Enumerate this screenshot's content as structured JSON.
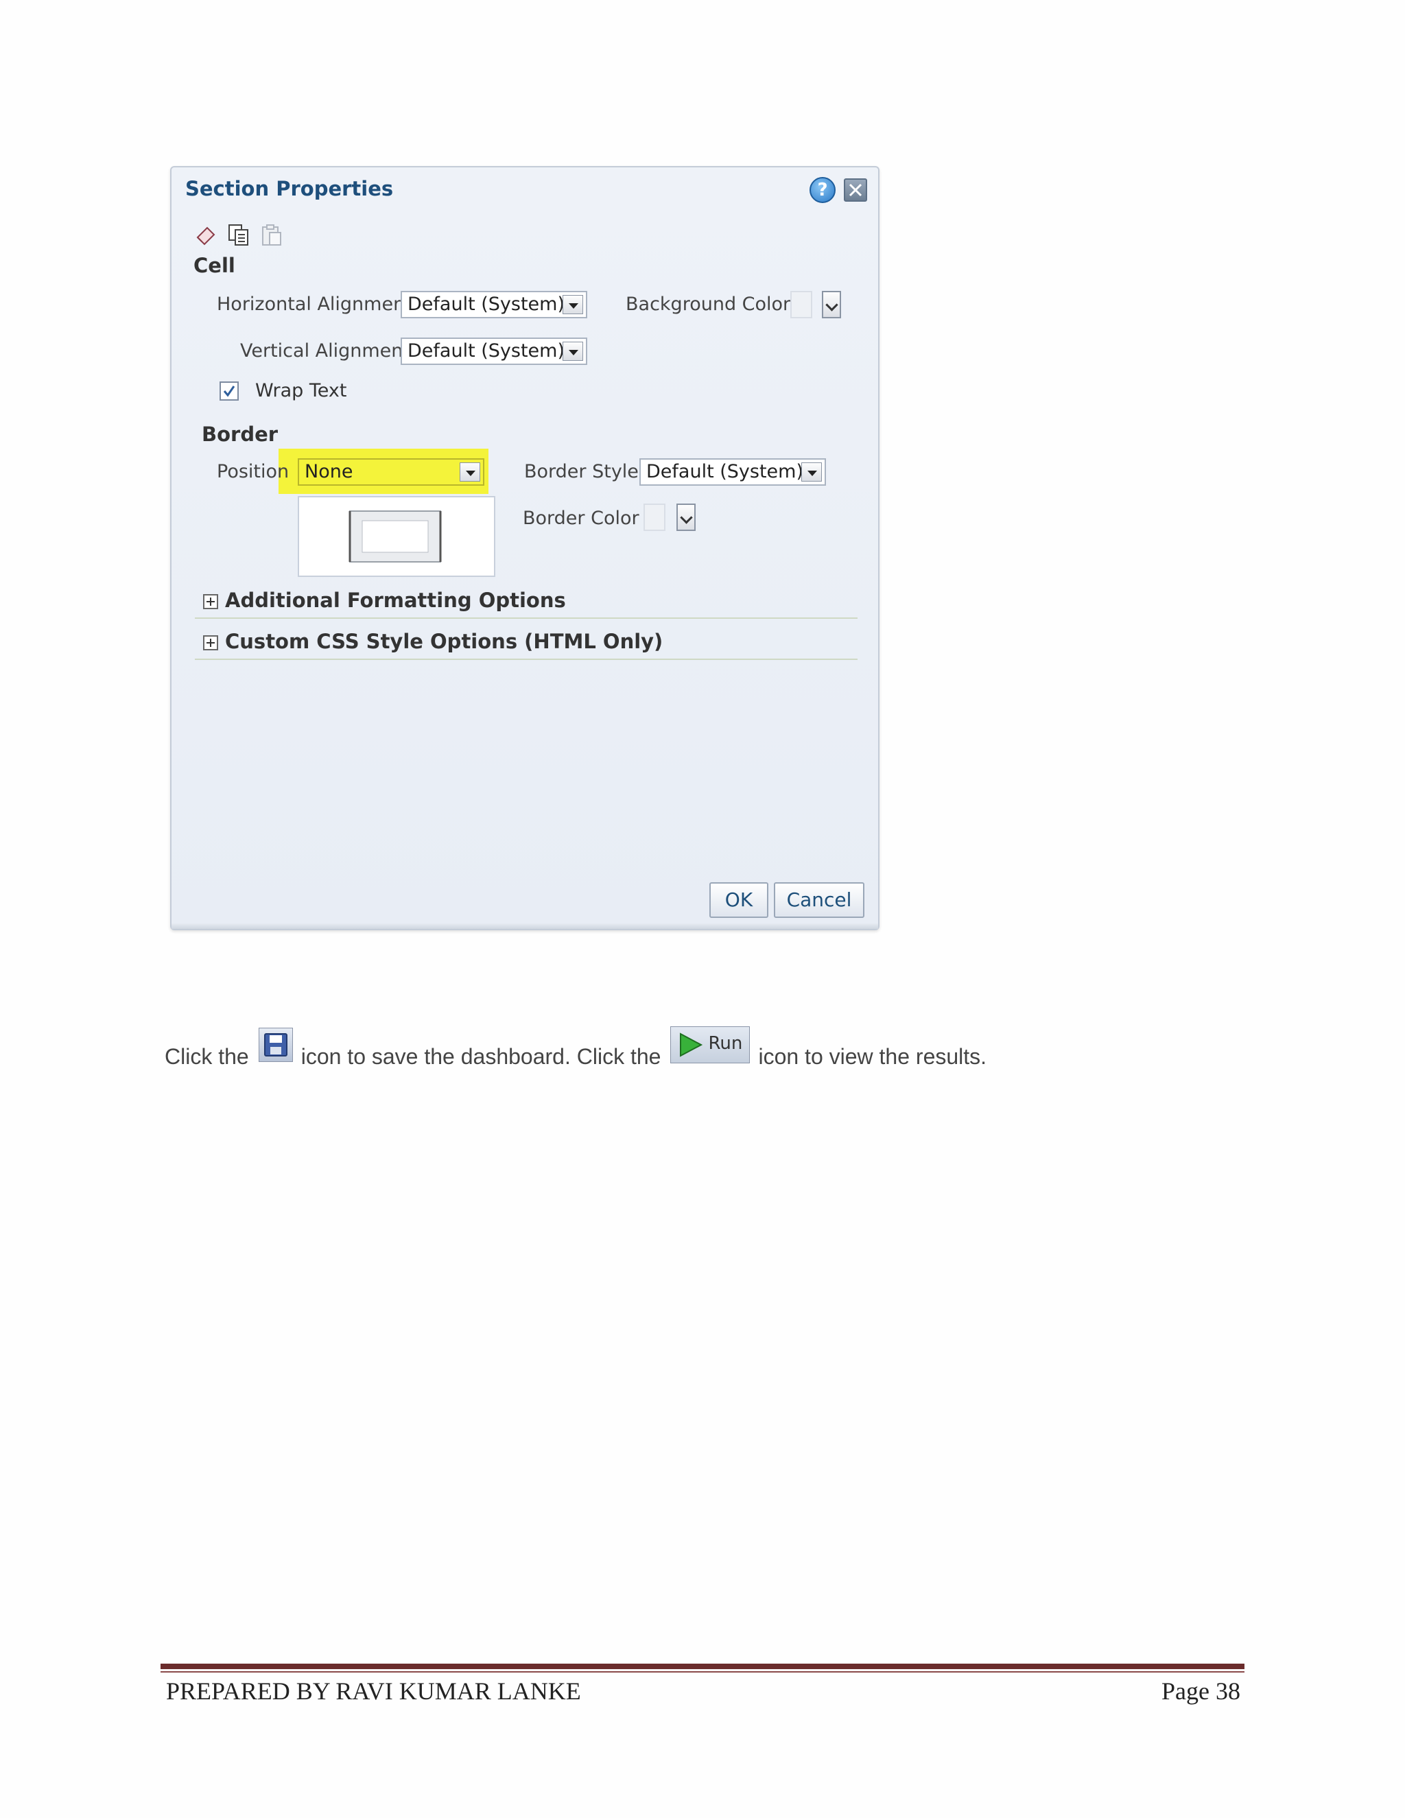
{
  "dialog": {
    "title": "Section Properties",
    "cell_heading": "Cell",
    "horizontal_alignment_label": "Horizontal Alignment",
    "horizontal_alignment_value": "Default (System)",
    "background_color_label": "Background Color",
    "vertical_alignment_label": "Vertical Alignment",
    "vertical_alignment_value": "Default (System)",
    "wrap_text_label": "Wrap Text",
    "wrap_text_checked": true,
    "border_heading": "Border",
    "position_label": "Position",
    "position_value": "None",
    "border_style_label": "Border Style",
    "border_style_value": "Default (System)",
    "border_color_label": "Border Color",
    "additional_formatting_label": "Additional Formatting Options",
    "custom_css_label": "Custom CSS Style Options (HTML Only)",
    "ok_label": "OK",
    "cancel_label": "Cancel",
    "highlight_color": "#f4f33a",
    "title_color": "#1e4f7c"
  },
  "instruction": {
    "part1": "Click the",
    "part2": "icon to save the dashboard. Click the",
    "run_label": "Run",
    "part3": "icon to view the results."
  },
  "footer": {
    "prepared_by": "PREPARED BY RAVI KUMAR LANKE",
    "page": "Page 38",
    "rule_color": "#6a2c2c"
  }
}
